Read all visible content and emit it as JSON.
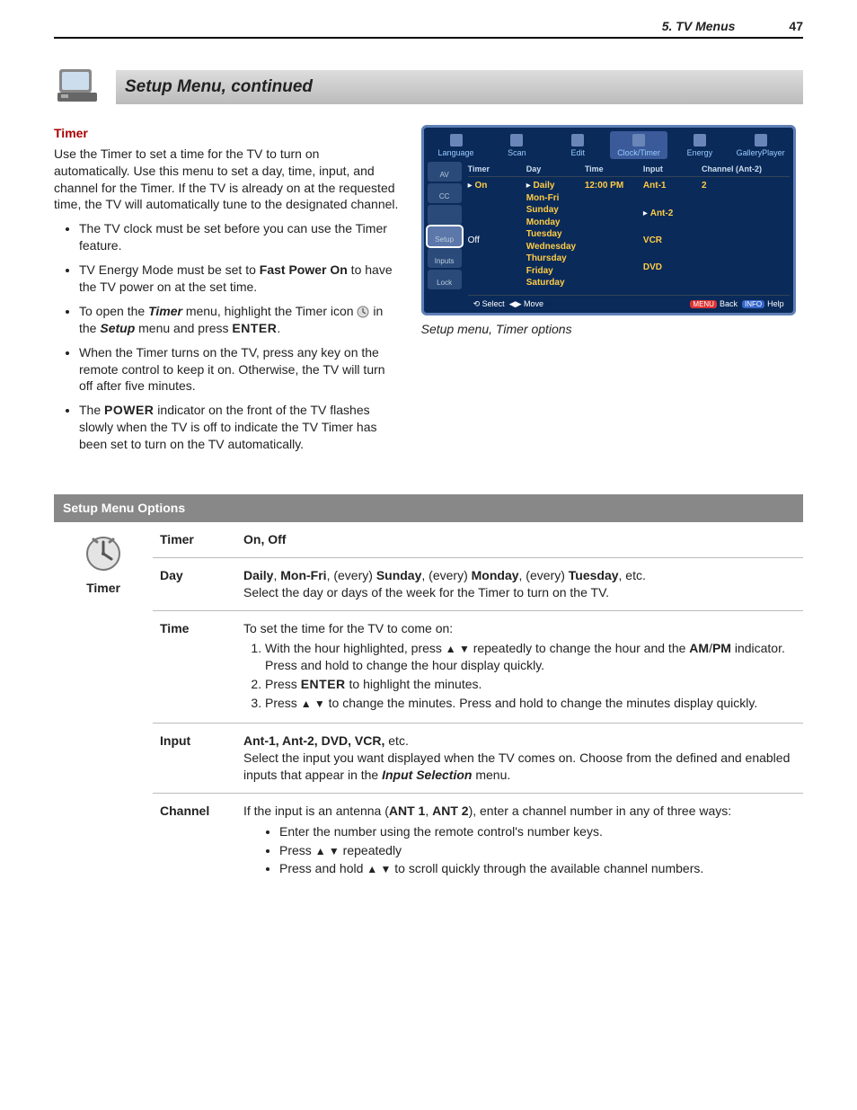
{
  "header": {
    "chapter": "5.  TV Menus",
    "page": "47"
  },
  "section": {
    "title": "Setup Menu, continued"
  },
  "timer_section": {
    "heading": "Timer",
    "intro": "Use the Timer to set a time for the TV to turn on automatically.  Use this menu to set a day, time, input, and channel for the Timer.  If the TV is already on at the requested time, the TV will automatically tune to the designated channel.",
    "bullets": {
      "b1": "The TV clock must be set before you can use the Timer feature.",
      "b2a": "TV Energy Mode must be set to ",
      "b2b": "Fast Power On",
      "b2c": " to have the TV power on at the set time.",
      "b3a": "To open the ",
      "b3b": "Timer",
      "b3c": " menu, highlight the Timer icon ",
      "b3d": " in the ",
      "b3e": "Setup",
      "b3f": " menu and press ",
      "b3g": "ENTER",
      "b3h": ".",
      "b4": "When the Timer turns on the TV, press any key on the remote control to keep it on.  Otherwise, the TV will turn off after five minutes.",
      "b5a": "The ",
      "b5b": "POWER",
      "b5c": " indicator on the front of the TV flashes slowly when the TV is off to indicate the TV Timer has been set to turn on the TV automatically."
    }
  },
  "osd": {
    "top": [
      "Language",
      "Scan",
      "Edit",
      "Clock/Timer",
      "Energy",
      "GalleryPlayer"
    ],
    "left": [
      "AV",
      "CC",
      "",
      "Setup",
      "Inputs",
      "Lock"
    ],
    "cols": [
      "Timer",
      "Day",
      "Time",
      "Input",
      "Channel (Ant-2)"
    ],
    "timer_opts": [
      "On",
      "Off"
    ],
    "day_opts": [
      "Daily",
      "Mon-Fri",
      "Sunday",
      "Monday",
      "Tuesday",
      "Wednesday",
      "Thursday",
      "Friday",
      "Saturday"
    ],
    "time_val": "12:00 PM",
    "input_opts": [
      "Ant-1",
      "Ant-2",
      "VCR",
      "DVD"
    ],
    "channel_val": "2",
    "foot": {
      "select": "Select",
      "move": "Move",
      "back": "Back",
      "help": "Help",
      "menu": "MENU",
      "info": "INFO"
    },
    "caption": "Setup menu, Timer options"
  },
  "table": {
    "title": "Setup Menu Options",
    "side_label": "Timer",
    "rows": {
      "timer": {
        "key": "Timer",
        "val_bold": "On, Off"
      },
      "day": {
        "key": "Day",
        "line1": {
          "a": "Daily",
          "b": ", ",
          "c": "Mon-Fri",
          "d": ", (every) ",
          "e": "Sunday",
          "f": ", (every) ",
          "g": "Monday",
          "h": ", (every) ",
          "i": "Tuesday",
          "j": ", etc."
        },
        "line2": "Select the day or days of the week for the Timer to turn on the TV."
      },
      "time": {
        "key": "Time",
        "intro": "To set the time for the TV to come on:",
        "li1a": "With the hour highlighted, press ",
        "li1b": "  repeatedly to change the hour and the ",
        "li1c": "AM",
        "li1d": "/",
        "li1e": "PM",
        "li1f": " indicator.  Press and hold to change the hour display quickly.",
        "li2a": "Press ",
        "li2b": "ENTER",
        "li2c": " to highlight the minutes.",
        "li3a": "Press ",
        "li3b": " to change the minutes.  Press and hold to change the minutes display quickly."
      },
      "input": {
        "key": "Input",
        "line1": {
          "a": "Ant-1, Ant-2, DVD, VCR,",
          "b": " etc."
        },
        "line2a": "Select the input you want displayed when the TV comes on.  Choose from the defined and enabled inputs that appear in the ",
        "line2b": "Input Selection",
        "line2c": " menu."
      },
      "channel": {
        "key": "Channel",
        "intro_a": "If the input is an antenna (",
        "intro_b": "ANT 1",
        "intro_c": ", ",
        "intro_d": "ANT 2",
        "intro_e": "), enter a channel number in any of three ways:",
        "li1": "Enter the number using the remote control's number keys.",
        "li2a": "Press ",
        "li2b": " repeatedly",
        "li3a": "Press and hold  ",
        "li3b": " to scroll quickly through the available channel numbers."
      }
    }
  }
}
